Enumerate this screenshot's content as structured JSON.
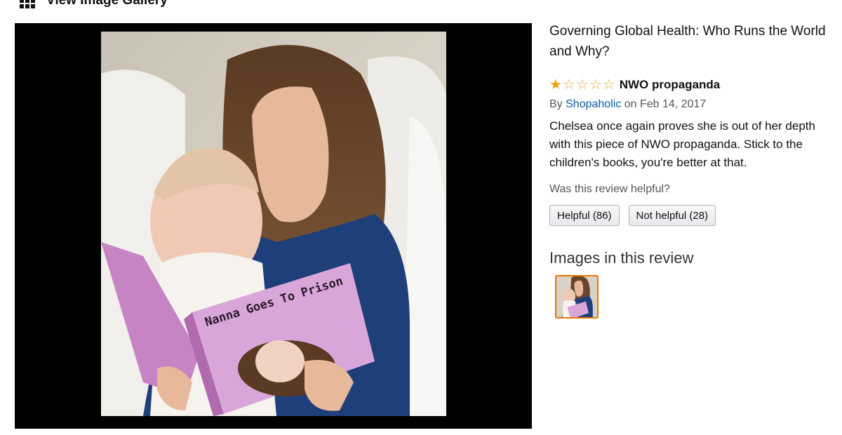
{
  "gallery": {
    "title": "View Image Gallery",
    "icon": "grid-icon"
  },
  "product": {
    "title": "Governing Global Health: Who Runs the World and Why?"
  },
  "review": {
    "rating": 1,
    "rating_max": 5,
    "title": "NWO propaganda",
    "by_prefix": "By",
    "author": "Shopaholic",
    "date": "on Feb 14, 2017",
    "body": "Chelsea once again proves she is out of her depth with this piece of NWO propaganda. Stick to the children's books, you're better at that.",
    "helpful_question": "Was this review helpful?",
    "helpful_button": "Helpful (86)",
    "not_helpful_button": "Not helpful (28)"
  },
  "images_section": {
    "heading": "Images in this review",
    "thumbnail_count": 1
  },
  "photo": {
    "book_title": "Nanna Goes To Prison"
  },
  "colors": {
    "star": "#f0a00f",
    "link": "#0a5bab",
    "thumb_border": "#e77600",
    "book_pink": "#d9a6d9"
  }
}
